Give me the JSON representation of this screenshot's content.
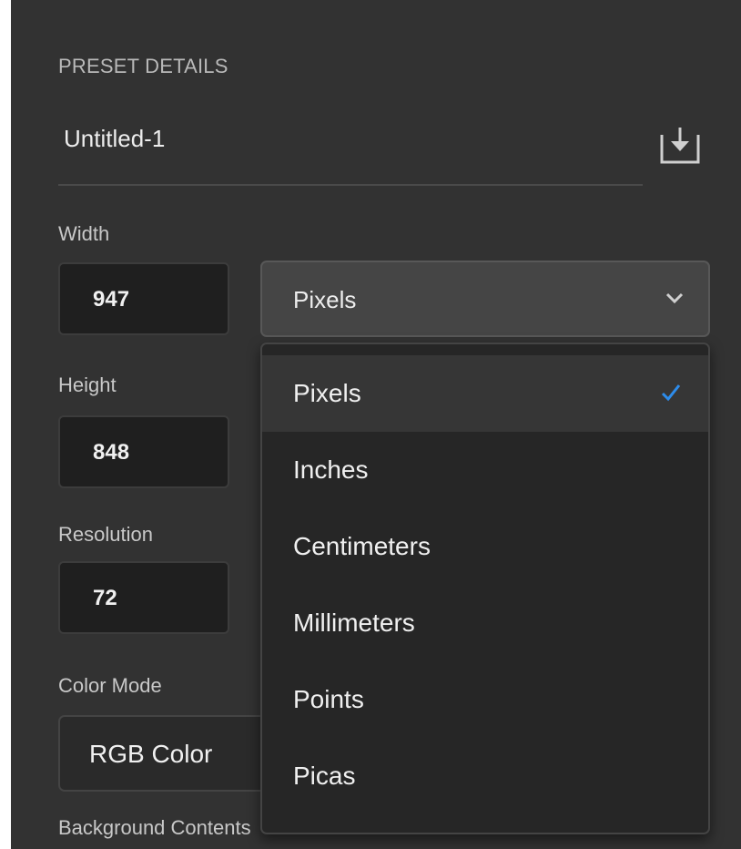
{
  "preset": {
    "section_title": "PRESET DETAILS",
    "document_name": "Untitled-1"
  },
  "fields": {
    "width_label": "Width",
    "width_value": "947",
    "height_label": "Height",
    "height_value": "848",
    "resolution_label": "Resolution",
    "resolution_value": "72",
    "color_mode_label": "Color Mode",
    "color_mode_value": "RGB Color",
    "background_label": "Background Contents"
  },
  "units_select": {
    "selected": "Pixels",
    "options": [
      {
        "label": "Pixels",
        "checked": true
      },
      {
        "label": "Inches",
        "checked": false
      },
      {
        "label": "Centimeters",
        "checked": false
      },
      {
        "label": "Millimeters",
        "checked": false
      },
      {
        "label": "Points",
        "checked": false
      },
      {
        "label": "Picas",
        "checked": false
      }
    ]
  },
  "icons": {
    "save_preset": "save-preset-icon",
    "dropdown": "chevron-down-icon",
    "checkmark": "checkmark-icon"
  },
  "colors": {
    "panel_bg": "#323232",
    "check_accent": "#2d8ceb"
  }
}
